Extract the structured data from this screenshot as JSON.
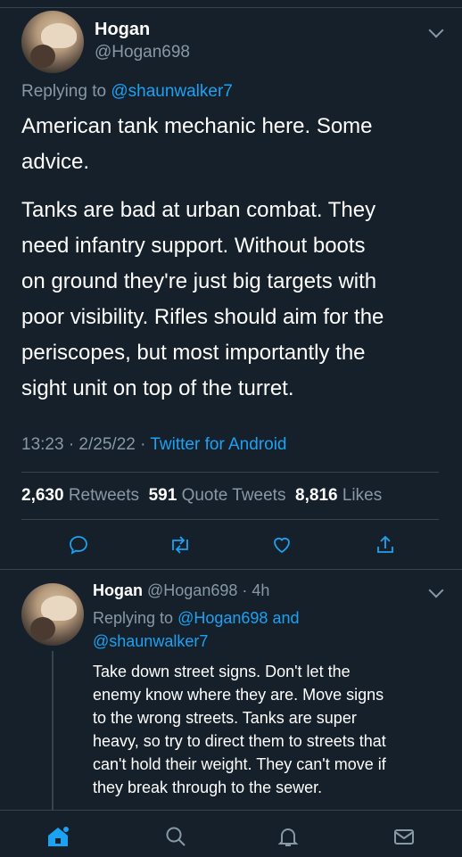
{
  "tweet": {
    "author_name": "Hogan",
    "author_handle": "@Hogan698",
    "replying_prefix": "Replying to",
    "replying_to": "@shaunwalker7",
    "paragraph1_line1": "American tank mechanic here. Some",
    "paragraph1_line2": "advice.",
    "paragraph2_lines": [
      "Tanks are bad at urban combat. They",
      "need infantry support. Without boots",
      "on ground they're just big targets with",
      "poor visibility. Rifles should aim for the",
      "periscopes, but most importantly the",
      "sight unit on top of the turret."
    ],
    "time": "13:23 · 2/25/22 ·",
    "source": "Twitter for Android",
    "retweets_count": "2,630",
    "retweets_label": "Retweets",
    "quotes_count": "591",
    "quotes_label": "Quote Tweets",
    "likes_count": "8,816",
    "likes_label": "Likes"
  },
  "reply": {
    "author_name": "Hogan",
    "handle_time": "@Hogan698 · 4h",
    "replying_prefix": "Replying to",
    "replying_to_1": "@Hogan698",
    "and": "and",
    "replying_to_2": "@shaunwalker7",
    "lines": [
      "Take down street signs. Don't let the",
      "enemy know where they are. Move signs",
      "to the wrong streets. Tanks are super",
      "heavy, so try to direct them to streets that",
      "can't hold their weight. They can't move if",
      "they break through to the sewer."
    ]
  },
  "icons": {
    "reply": "reply-icon",
    "retweet": "retweet-icon",
    "like": "heart-icon",
    "share": "share-icon",
    "home": "home-icon",
    "search": "search-icon",
    "notifications": "bell-icon",
    "messages": "mail-icon"
  },
  "colors": {
    "background": "#15202b",
    "accent": "#1da1f2",
    "muted": "#8899a6",
    "divider": "#38444d"
  }
}
